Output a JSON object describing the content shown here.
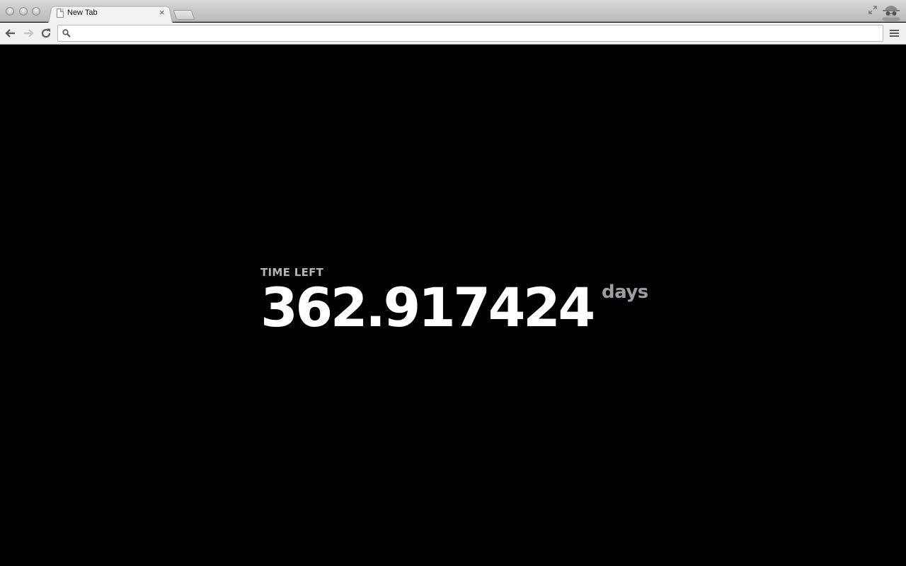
{
  "browser": {
    "tab_title": "New Tab",
    "tab_close_glyph": "×",
    "omnibox_value": "",
    "icons": {
      "back": "back-arrow-icon",
      "forward": "forward-arrow-icon",
      "reload": "reload-icon",
      "search": "search-icon",
      "menu": "menu-icon",
      "fullscreen": "fullscreen-icon",
      "incognito": "incognito-icon"
    }
  },
  "countdown": {
    "label": "TIME LEFT",
    "value": "362.917424",
    "unit": "days"
  },
  "colors": {
    "background": "#000000",
    "value": "#ffffff",
    "label": "#b4b6ba",
    "unit": "#9d9fa3"
  }
}
